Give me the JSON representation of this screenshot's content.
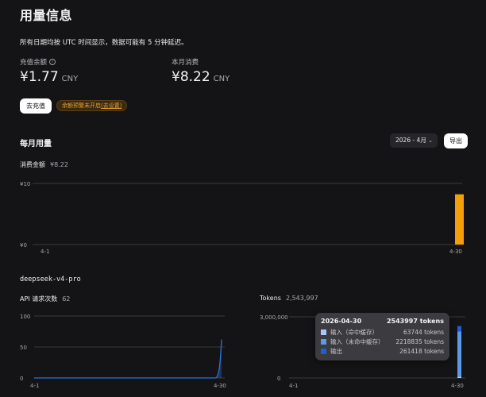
{
  "page": {
    "title": "用量信息",
    "notice": "所有日期均按 UTC 时间显示，数据可能有 5 分钟延迟。"
  },
  "balance": {
    "label": "充值余额",
    "value": "¥1.77",
    "currency": "CNY",
    "topup_label": "去充值",
    "alert_text": "余额预警未开启",
    "alert_link": "(去设置)"
  },
  "monthly_spend": {
    "label": "本月消费",
    "value": "¥8.22",
    "currency": "CNY"
  },
  "monthly_usage": {
    "title": "每月用量",
    "month_selected": "2026 - 4月",
    "export_label": "导出"
  },
  "colors": {
    "cost_bar": "#f59e0b",
    "api_line": "#2f6fdc",
    "cached_input": "#a9c8f5",
    "uncached_input": "#5b9ae6",
    "output": "#1f5ed8"
  },
  "model": {
    "name": "deepseek-v4-pro"
  },
  "chart_data": [
    {
      "type": "bar",
      "title": "消费金额",
      "subtitle": "¥8.22",
      "x": [
        "4-1",
        "4-30"
      ],
      "y_ticks": [
        "¥0",
        "¥10"
      ],
      "ylim": [
        0,
        10
      ],
      "series": [
        {
          "values": [
            0,
            0,
            0,
            0,
            0,
            0,
            0,
            0,
            0,
            0,
            0,
            0,
            0,
            0,
            0,
            0,
            0,
            0,
            0,
            0,
            0,
            0,
            0,
            0,
            0,
            0,
            0,
            0,
            0,
            8.22
          ]
        }
      ],
      "x_tick_labels": [
        "4-1",
        "4-30"
      ]
    },
    {
      "type": "area",
      "title": "API 请求次数",
      "subtitle": "62",
      "ylim": [
        0,
        100
      ],
      "y_ticks": [
        "0",
        "50",
        "100"
      ],
      "x_tick_labels": [
        "4-1",
        "4-30"
      ],
      "series": [
        {
          "values": [
            0,
            0,
            0,
            0,
            0,
            0,
            0,
            0,
            0,
            0,
            0,
            0,
            0,
            0,
            0,
            0,
            0,
            0,
            0,
            0,
            0,
            0,
            0,
            0,
            0,
            0,
            0,
            0,
            0,
            62
          ]
        }
      ]
    },
    {
      "type": "bar",
      "title": "Tokens",
      "subtitle": "2,543,997",
      "ylim": [
        0,
        3000000
      ],
      "y_ticks": [
        "0",
        "3,000,000"
      ],
      "x_tick_labels": [
        "4-1",
        "4-30"
      ],
      "series": [
        {
          "name": "输入（命中缓存）",
          "values": [
            0,
            0,
            0,
            0,
            0,
            0,
            0,
            0,
            0,
            0,
            0,
            0,
            0,
            0,
            0,
            0,
            0,
            0,
            0,
            0,
            0,
            0,
            0,
            0,
            0,
            0,
            0,
            0,
            0,
            63744
          ]
        },
        {
          "name": "输入（未命中缓存）",
          "values": [
            0,
            0,
            0,
            0,
            0,
            0,
            0,
            0,
            0,
            0,
            0,
            0,
            0,
            0,
            0,
            0,
            0,
            0,
            0,
            0,
            0,
            0,
            0,
            0,
            0,
            0,
            0,
            0,
            0,
            2218835
          ]
        },
        {
          "name": "输出",
          "values": [
            0,
            0,
            0,
            0,
            0,
            0,
            0,
            0,
            0,
            0,
            0,
            0,
            0,
            0,
            0,
            0,
            0,
            0,
            0,
            0,
            0,
            0,
            0,
            0,
            0,
            0,
            0,
            0,
            0,
            261418
          ]
        }
      ],
      "tooltip": {
        "date": "2026-04-30",
        "total": "2543997 tokens",
        "rows": [
          {
            "label": "输入（命中缓存）",
            "value": "63744 tokens"
          },
          {
            "label": "输入（未命中缓存）",
            "value": "2218835 tokens"
          },
          {
            "label": "输出",
            "value": "261418 tokens"
          }
        ]
      }
    }
  ]
}
